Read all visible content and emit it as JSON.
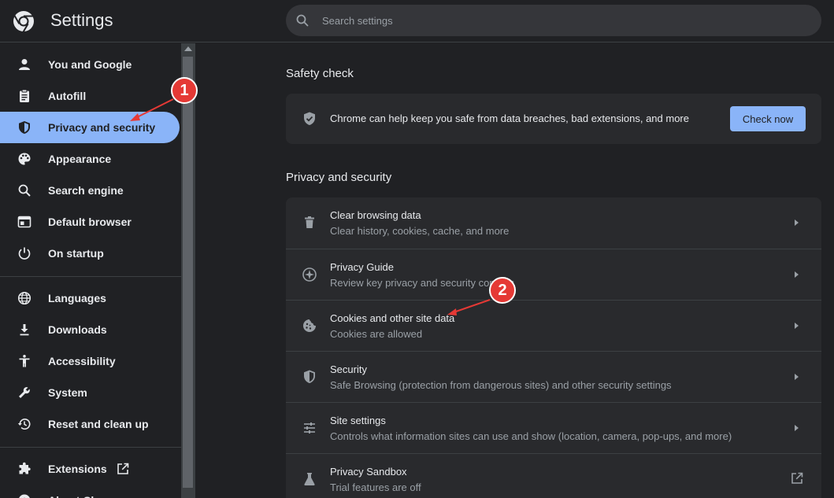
{
  "header": {
    "title": "Settings",
    "search_placeholder": "Search settings"
  },
  "sidebar": {
    "items": [
      {
        "label": "You and Google",
        "icon": "person-icon"
      },
      {
        "label": "Autofill",
        "icon": "clipboard-icon"
      },
      {
        "label": "Privacy and security",
        "icon": "shield-icon",
        "active": true
      },
      {
        "label": "Appearance",
        "icon": "palette-icon"
      },
      {
        "label": "Search engine",
        "icon": "search-icon"
      },
      {
        "label": "Default browser",
        "icon": "browser-window-icon"
      },
      {
        "label": "On startup",
        "icon": "power-icon"
      },
      {
        "label": "Languages",
        "icon": "globe-icon"
      },
      {
        "label": "Downloads",
        "icon": "download-icon"
      },
      {
        "label": "Accessibility",
        "icon": "accessibility-icon"
      },
      {
        "label": "System",
        "icon": "wrench-icon"
      },
      {
        "label": "Reset and clean up",
        "icon": "history-icon"
      },
      {
        "label": "Extensions",
        "icon": "puzzle-icon"
      },
      {
        "label": "About Chrome",
        "icon": "chrome-icon"
      }
    ]
  },
  "safety_check": {
    "title": "Safety check",
    "text": "Chrome can help keep you safe from data breaches, bad extensions, and more",
    "button": "Check now"
  },
  "privacy": {
    "title": "Privacy and security",
    "rows": [
      {
        "title": "Clear browsing data",
        "subtitle": "Clear history, cookies, cache, and more",
        "icon": "trash-icon"
      },
      {
        "title": "Privacy Guide",
        "subtitle": "Review key privacy and security controls",
        "icon": "compass-icon"
      },
      {
        "title": "Cookies and other site data",
        "subtitle": "Cookies are allowed",
        "icon": "cookie-icon"
      },
      {
        "title": "Security",
        "subtitle": "Safe Browsing (protection from dangerous sites) and other security settings",
        "icon": "shield-icon"
      },
      {
        "title": "Site settings",
        "subtitle": "Controls what information sites can use and show (location, camera, pop-ups, and more)",
        "icon": "sliders-icon"
      },
      {
        "title": "Privacy Sandbox",
        "subtitle": "Trial features are off",
        "icon": "flask-icon"
      }
    ]
  },
  "annotations": {
    "badge_1": "1",
    "badge_2": "2",
    "color": "#e53935"
  },
  "colors": {
    "background": "#202124",
    "card": "#292a2d",
    "accent": "#8ab4f8",
    "text": "#e8eaed",
    "muted": "#9aa0a6"
  }
}
